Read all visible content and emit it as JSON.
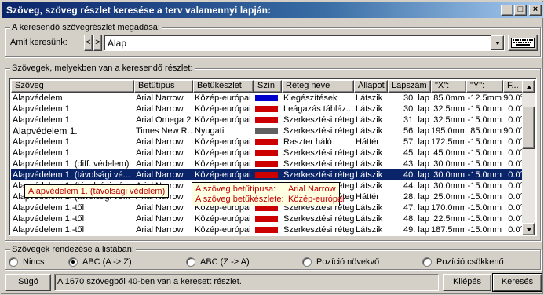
{
  "window": {
    "title": "Szöveg, szöveg részlet keresése a terv valamennyi lapján:",
    "minimize": "_",
    "maximize": "□",
    "close": "×"
  },
  "search": {
    "group_label": "A keresendő szövegrészlet megadása:",
    "label": "Amit keresünk:",
    "prev": "<",
    "next": ">",
    "value": "Alap"
  },
  "results": {
    "group_label": "Szövegek, melyekben van a keresendő részlet:",
    "columns": [
      "Szöveg",
      "Betűtípus",
      "Betűkészlet",
      "Szín",
      "Réteg neve",
      "Állapot",
      "Lapszám",
      "\"X\":",
      "\"Y\":",
      "F..."
    ],
    "rows": [
      {
        "text": "Alapvédelem",
        "font": "Arial Narrow",
        "charset": "Közép-európai",
        "color": "#0000cc",
        "layer": "Kiegészítések",
        "state": "Látszik",
        "page": "30. lap",
        "x": "85.0mm",
        "y": "-12.5mm",
        "f": "90.0°"
      },
      {
        "text": "Alapvédelem 1.",
        "font": "Arial Narrow",
        "charset": "Közép-európai",
        "color": "#cc0000",
        "layer": "Leágazás tábláz...",
        "state": "Látszik",
        "page": "30. lap",
        "x": "32.5mm",
        "y": "-15.0mm",
        "f": "0.0°"
      },
      {
        "text": "Alapvédelem 1.",
        "font": "Arial Omega 2...",
        "charset": "Közép-európai",
        "color": "#cc0000",
        "layer": "Szerkesztési réteg",
        "state": "Látszik",
        "page": "31. lap",
        "x": "32.5mm",
        "y": "-15.0mm",
        "f": "0.0°"
      },
      {
        "text": "Alapvédelem 1.",
        "font": "Times New R...",
        "charset": "Nyugati",
        "color": "#606060",
        "layer": "Szerkesztési réteg",
        "state": "Látszik",
        "page": "56. lap",
        "x": "195.0mm",
        "y": "85.0mm",
        "f": "90.0°"
      },
      {
        "text": "Alapvédelem 1.",
        "font": "Arial Narrow",
        "charset": "Közép-európai",
        "color": "#cc0000",
        "layer": "Raszter háló",
        "state": "Háttér",
        "page": "57. lap",
        "x": "172.5mm",
        "y": "-15.0mm",
        "f": "0.0°"
      },
      {
        "text": "Alapvédelem 1.",
        "font": "Arial Narrow",
        "charset": "Közép-európai",
        "color": "#cc0000",
        "layer": "Szerkesztési réteg",
        "state": "Látszik",
        "page": "45. lap",
        "x": "45.0mm",
        "y": "-15.0mm",
        "f": "0.0°"
      },
      {
        "text": "Alapvédelem 1. (diff. védelem)",
        "font": "Arial Narrow",
        "charset": "Közép-európai",
        "color": "#cc0000",
        "layer": "Szerkesztési réteg",
        "state": "Látszik",
        "page": "43. lap",
        "x": "30.0mm",
        "y": "-15.0mm",
        "f": "0.0°"
      },
      {
        "text": "Alapvédelem 1. (távolsági vé...",
        "font": "Arial Narrow",
        "charset": "Közép-európai",
        "color": "#cc0000",
        "layer": "Szerkesztési réteg",
        "state": "Látszik",
        "page": "40. lap",
        "x": "30.0mm",
        "y": "-15.0mm",
        "f": "0.0°"
      },
      {
        "text": "Alapvédelem 1. (távolsági vé...",
        "font": "Arial Narrow",
        "charset": "Közép-európai",
        "color": "#cc0000",
        "layer": "Szerkesztési réteg",
        "state": "Látszik",
        "page": "44. lap",
        "x": "30.0mm",
        "y": "-15.0mm",
        "f": "0.0°"
      },
      {
        "text": "Alapvédelem 1. (távolsági vé...",
        "font": "Arial Narrow",
        "charset": "Közép-európai",
        "color": "#cc0000",
        "layer": "Szerkesztési réteg",
        "state": "Háttér",
        "page": "28. lap",
        "x": "25.0mm",
        "y": "-15.0mm",
        "f": "0.0°"
      },
      {
        "text": "Alapvédelem 1.-től",
        "font": "Arial Narrow",
        "charset": "Közép-európai",
        "color": "#cc0000",
        "layer": "Szerkesztési réteg",
        "state": "Látszik",
        "page": "47. lap",
        "x": "170.0mm",
        "y": "-15.0mm",
        "f": "0.0°"
      },
      {
        "text": "Alapvédelem 1.-től",
        "font": "Arial Narrow",
        "charset": "Közép-európai",
        "color": "#cc0000",
        "layer": "Szerkesztési réteg",
        "state": "Látszik",
        "page": "48. lap",
        "x": "22.5mm",
        "y": "-15.0mm",
        "f": "0.0°"
      },
      {
        "text": "Alapvédelem 1.-től",
        "font": "Arial Narrow",
        "charset": "Közép-európai",
        "color": "#cc0000",
        "layer": "Szerkesztési réteg",
        "state": "Látszik",
        "page": "49. lap",
        "x": "187.5mm",
        "y": "-15.0mm",
        "f": "0.0°"
      }
    ],
    "selected_index": 7,
    "tooltip_text": "Alapvédelem 1. (távolsági védelem)",
    "info_tooltip": {
      "font_label": "A szöveg betűtípusa:",
      "font_value": "Arial Narrow",
      "charset_label": "A szöveg betűkészlete:",
      "charset_value": "Közép-európai"
    }
  },
  "sort": {
    "group_label": "Szövegek rendezése a listában:",
    "options": [
      {
        "label": "Nincs",
        "selected": false
      },
      {
        "label": "ABC (A -> Z)",
        "selected": true
      },
      {
        "label": "ABC (Z -> A)",
        "selected": false
      },
      {
        "label": "Pozíció növekvő",
        "selected": false
      },
      {
        "label": "Pozíció csökkenő",
        "selected": false
      }
    ]
  },
  "footer": {
    "help": "Súgó",
    "status": "A 1670 szövegből 40-ben van a keresett részlet.",
    "exit": "Kilépés",
    "search": "Keresés"
  }
}
